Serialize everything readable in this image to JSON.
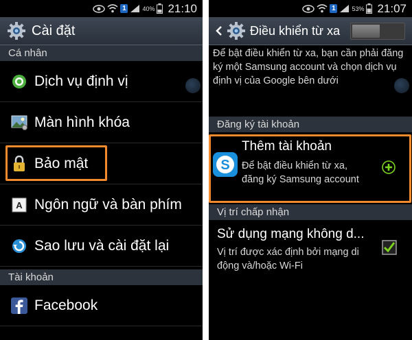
{
  "left": {
    "status": {
      "battery_pct": "40%",
      "time": "21:10",
      "badge": "1"
    },
    "title": "Cài đặt",
    "sections": [
      {
        "header": "Cá nhân"
      },
      {
        "header": "Tài khoản"
      }
    ],
    "items": [
      {
        "label": "Dịch vụ định vị",
        "icon": "location-icon"
      },
      {
        "label": "Màn hình khóa",
        "icon": "lockscreen-image-icon"
      },
      {
        "label": "Bảo mật",
        "icon": "lock-icon"
      },
      {
        "label": "Ngôn ngữ và bàn phím",
        "icon": "keyboard-letter-icon"
      },
      {
        "label": "Sao lưu và cài đặt lại",
        "icon": "backup-restore-icon"
      },
      {
        "label": "Facebook",
        "icon": "facebook-icon"
      }
    ]
  },
  "right": {
    "status": {
      "battery_pct": "53%",
      "time": "21:07",
      "badge": "1"
    },
    "title": "Điều khiển từ xa",
    "description": "Để bật điều khiển từ xa, bạn cần phải đăng ký một Samsung account và chọn dịch vụ định vị của Google bên dưới",
    "register_header": "Đăng ký tài khoản",
    "add_account": {
      "title": "Thêm tài khoản",
      "subtitle": "Để bật điều khiển từ xa, đăng ký Samsung account"
    },
    "location_header": "Vị trí chấp nhận",
    "wireless": {
      "title": "Sử dụng mạng không d...",
      "subtitle": "Vị trí được xác định bởi mạng di động và/hoặc Wi-Fi",
      "checked": true
    }
  },
  "colors": {
    "highlight": "#f08a2c",
    "accent_green": "#7ed321",
    "status_badge": "#1d66c2"
  }
}
